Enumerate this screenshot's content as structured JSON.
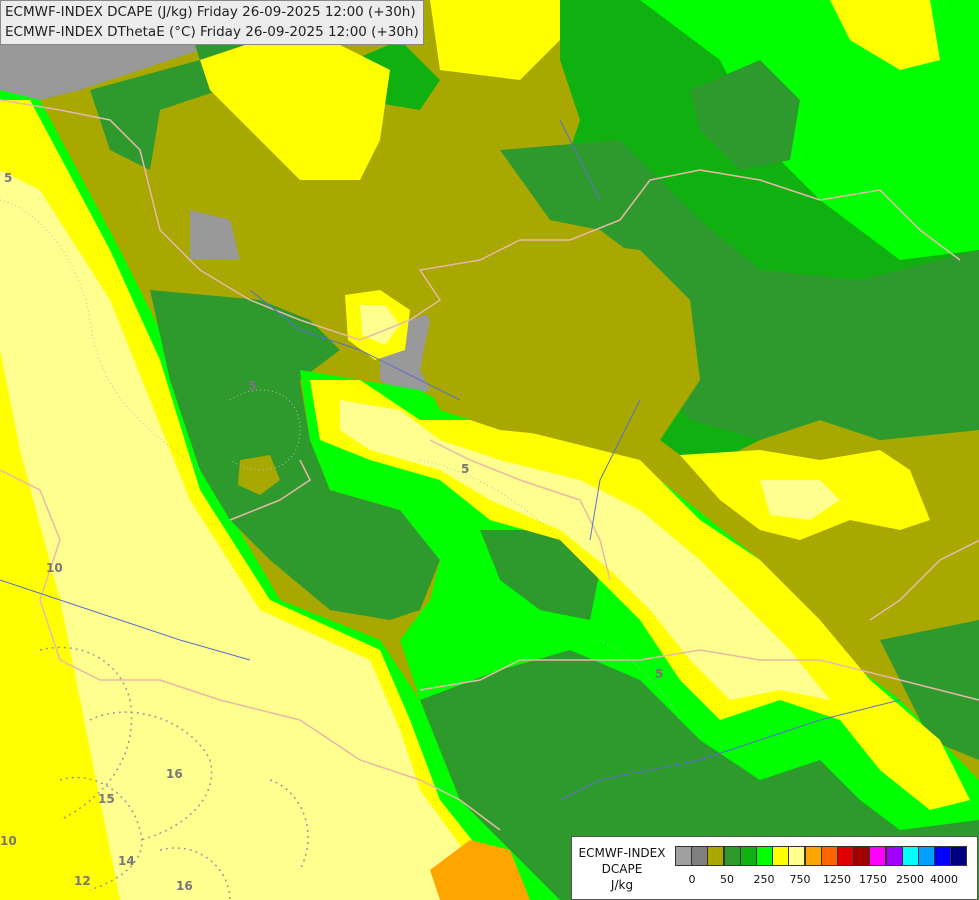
{
  "title": {
    "line1": "ECMWF-INDEX DCAPE (J/kg) Friday 26-09-2025 12:00 (+30h)",
    "line2": "ECMWF-INDEX DThetaE (°C) Friday 26-09-2025 12:00 (+30h)"
  },
  "legend": {
    "line1": "ECMWF-INDEX",
    "line2": "DCAPE",
    "line3": "J/kg",
    "colors": [
      "#a0a0a0",
      "#808080",
      "#a8a800",
      "#2e9a2e",
      "#10b010",
      "#00ff00",
      "#ffff00",
      "#ffff90",
      "#ffa500",
      "#ff6400",
      "#e00000",
      "#a00000",
      "#ff00ff",
      "#a000ff",
      "#00ffff",
      "#00a0ff",
      "#0000ff",
      "#000080"
    ],
    "ticks": [
      "0",
      "50",
      "250",
      "750",
      "1250",
      "1750",
      "2500",
      "4000"
    ]
  },
  "contour_labels": [
    "5",
    "5",
    "5",
    "5",
    "10",
    "10",
    "12",
    "14",
    "15",
    "16",
    "16"
  ],
  "colors": {
    "olive": "#a8a800",
    "dark_green": "#2e9a2e",
    "mid_green": "#10b010",
    "bright_green": "#00ff00",
    "yellow": "#ffff00",
    "light_yellow": "#ffff90",
    "orange": "#ffa500",
    "gray": "#999999"
  }
}
